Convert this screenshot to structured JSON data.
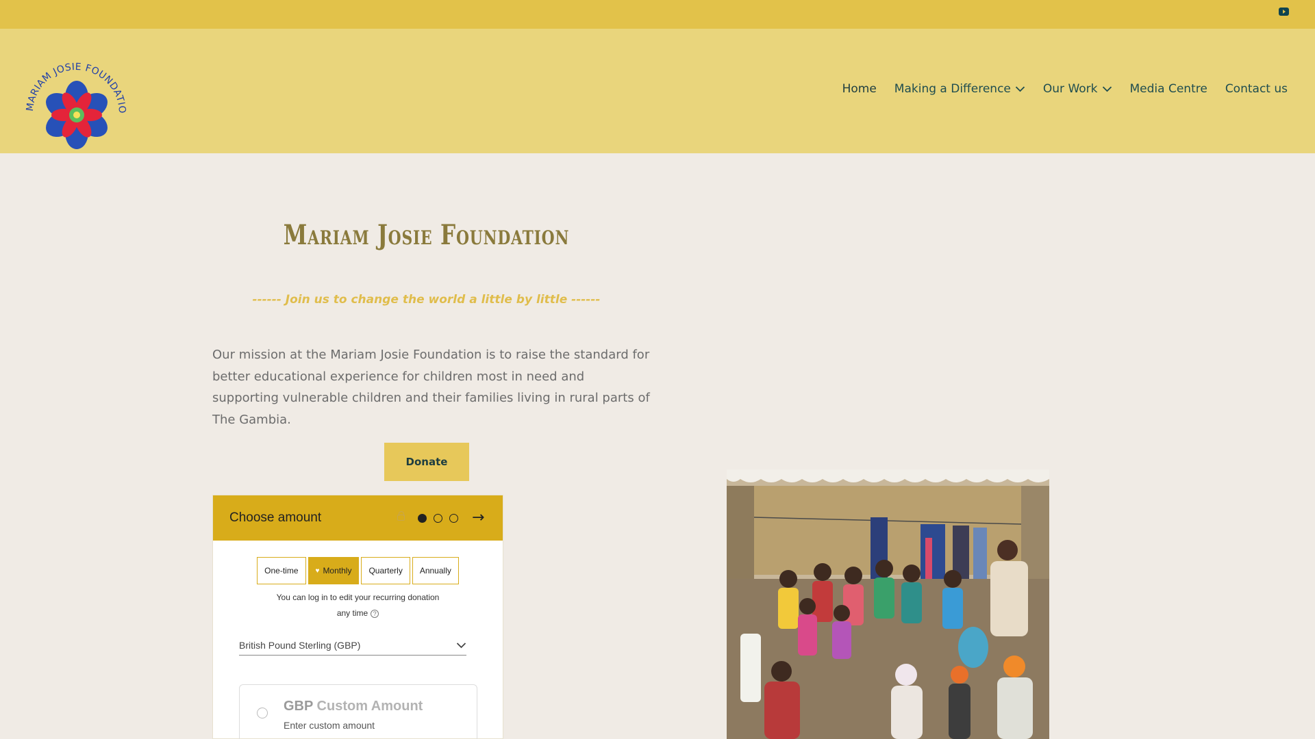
{
  "topbar": {
    "icon": "youtube-icon"
  },
  "header": {
    "logo_text": "MARIAM JOSIE FOUNDATION",
    "nav": [
      {
        "label": "Home",
        "dropdown": false,
        "active": true
      },
      {
        "label": "Making a Difference",
        "dropdown": true
      },
      {
        "label": "Our Work",
        "dropdown": true
      },
      {
        "label": "Media Centre",
        "dropdown": false
      },
      {
        "label": "Contact us",
        "dropdown": false
      }
    ]
  },
  "hero": {
    "title": "Mariam Josie Foundation",
    "tagline": "------ Join us to change the world a little by little ------",
    "mission": "Our mission at the Mariam Josie Foundation is to raise the standard for better educational experience for children most in need and supporting vulnerable children and their families living in rural parts of The Gambia.",
    "donate_label": "Donate"
  },
  "donation_widget": {
    "title": "Choose amount",
    "steps": {
      "total": 3,
      "current": 1
    },
    "frequencies": [
      "One-time",
      "Monthly",
      "Quarterly",
      "Annually"
    ],
    "selected_frequency": "Monthly",
    "recurring_note_line1": "You can log in to edit your recurring donation",
    "recurring_note_line2": "any time",
    "currency": "British Pound Sterling (GBP)",
    "custom_amount": {
      "currency_code": "GBP",
      "title": "Custom Amount",
      "subtitle": "Enter custom amount"
    }
  },
  "colors": {
    "topbar": "#e2c24a",
    "header": "#e9d57c",
    "accent": "#d8ac1a",
    "nav_text": "#1f4d4f",
    "page_bg": "#f0ebe5"
  }
}
